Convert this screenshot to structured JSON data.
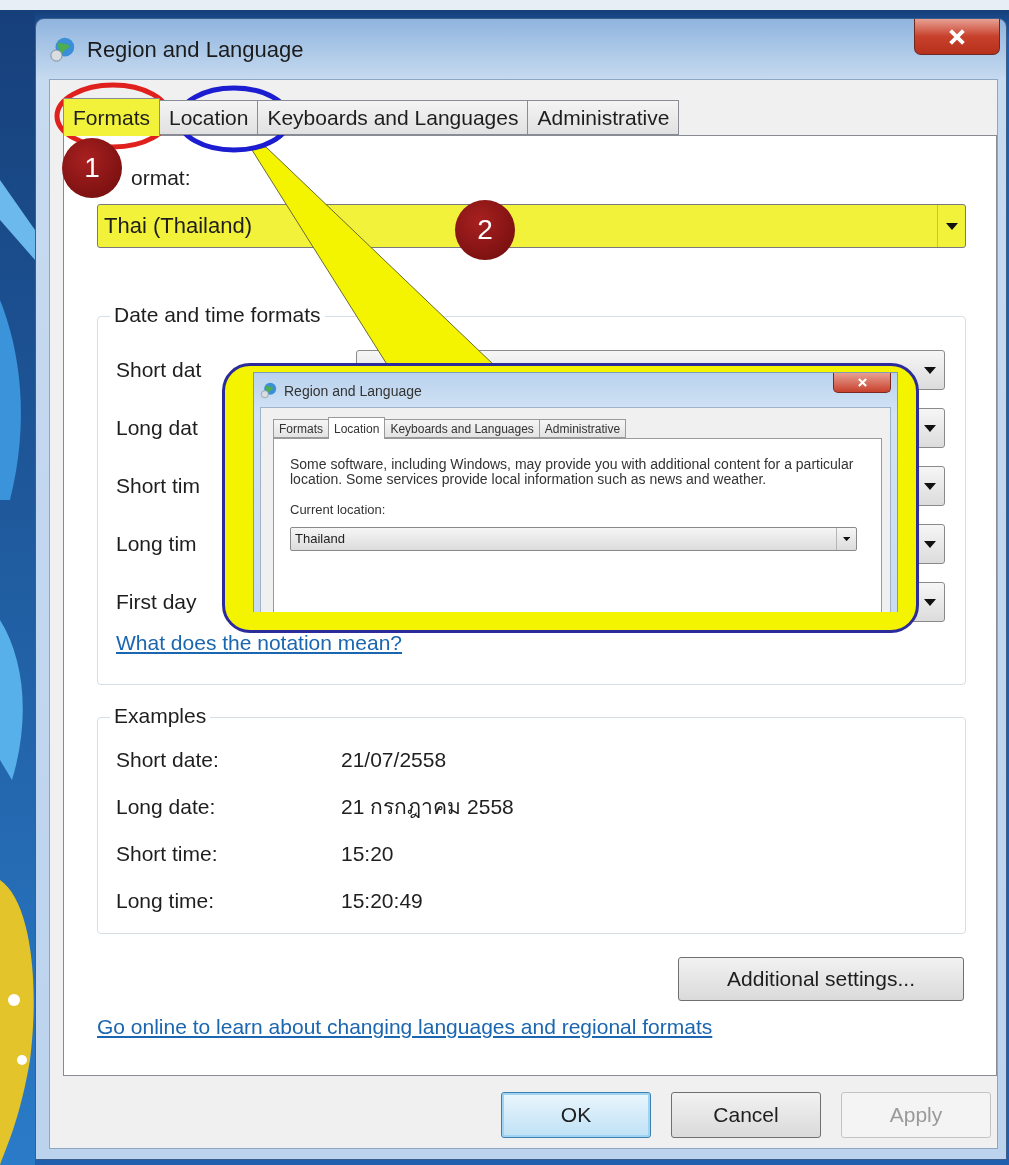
{
  "window": {
    "title": "Region and Language"
  },
  "tabs": [
    {
      "label": "Formats",
      "selected": true,
      "highlighted": true
    },
    {
      "label": "Location",
      "selected": false,
      "highlighted": false
    },
    {
      "label": "Keyboards and Languages",
      "selected": false,
      "highlighted": false
    },
    {
      "label": "Administrative",
      "selected": false,
      "highlighted": false
    }
  ],
  "format": {
    "label": "ormat:",
    "value": "Thai (Thailand)",
    "highlighted": true
  },
  "date_time_formats": {
    "title": "Date and time formats",
    "rows": [
      {
        "label": "Short dat"
      },
      {
        "label": "Long dat"
      },
      {
        "label": "Short tim"
      },
      {
        "label": "Long tim"
      },
      {
        "label": "First day"
      }
    ],
    "link": "What does the notation mean?"
  },
  "examples": {
    "title": "Examples",
    "rows": [
      {
        "label": "Short date:",
        "value": "21/07/2558"
      },
      {
        "label": "Long date:",
        "value": "21 กรกฎาคม 2558"
      },
      {
        "label": "Short time:",
        "value": "15:20"
      },
      {
        "label": "Long time:",
        "value": "15:20:49"
      }
    ]
  },
  "additional_settings": {
    "label": "Additional settings..."
  },
  "online_link": "Go online to learn about changing languages and regional formats",
  "buttons": [
    {
      "label": "OK",
      "default": true,
      "disabled": false
    },
    {
      "label": "Cancel",
      "default": false,
      "disabled": false
    },
    {
      "label": "Apply",
      "default": false,
      "disabled": true
    }
  ],
  "annotations": {
    "badges": [
      "1",
      "2"
    ],
    "inset": {
      "title": "Region and Language",
      "tabs": [
        {
          "label": "Formats",
          "selected": false
        },
        {
          "label": "Location",
          "selected": true
        },
        {
          "label": "Keyboards and Languages",
          "selected": false
        },
        {
          "label": "Administrative",
          "selected": false
        }
      ],
      "description": "Some software, including Windows, may provide you with additional content for a particular location. Some services provide local information such as news and weather.",
      "location_label": "Current location:",
      "location_value": "Thailand"
    }
  }
}
